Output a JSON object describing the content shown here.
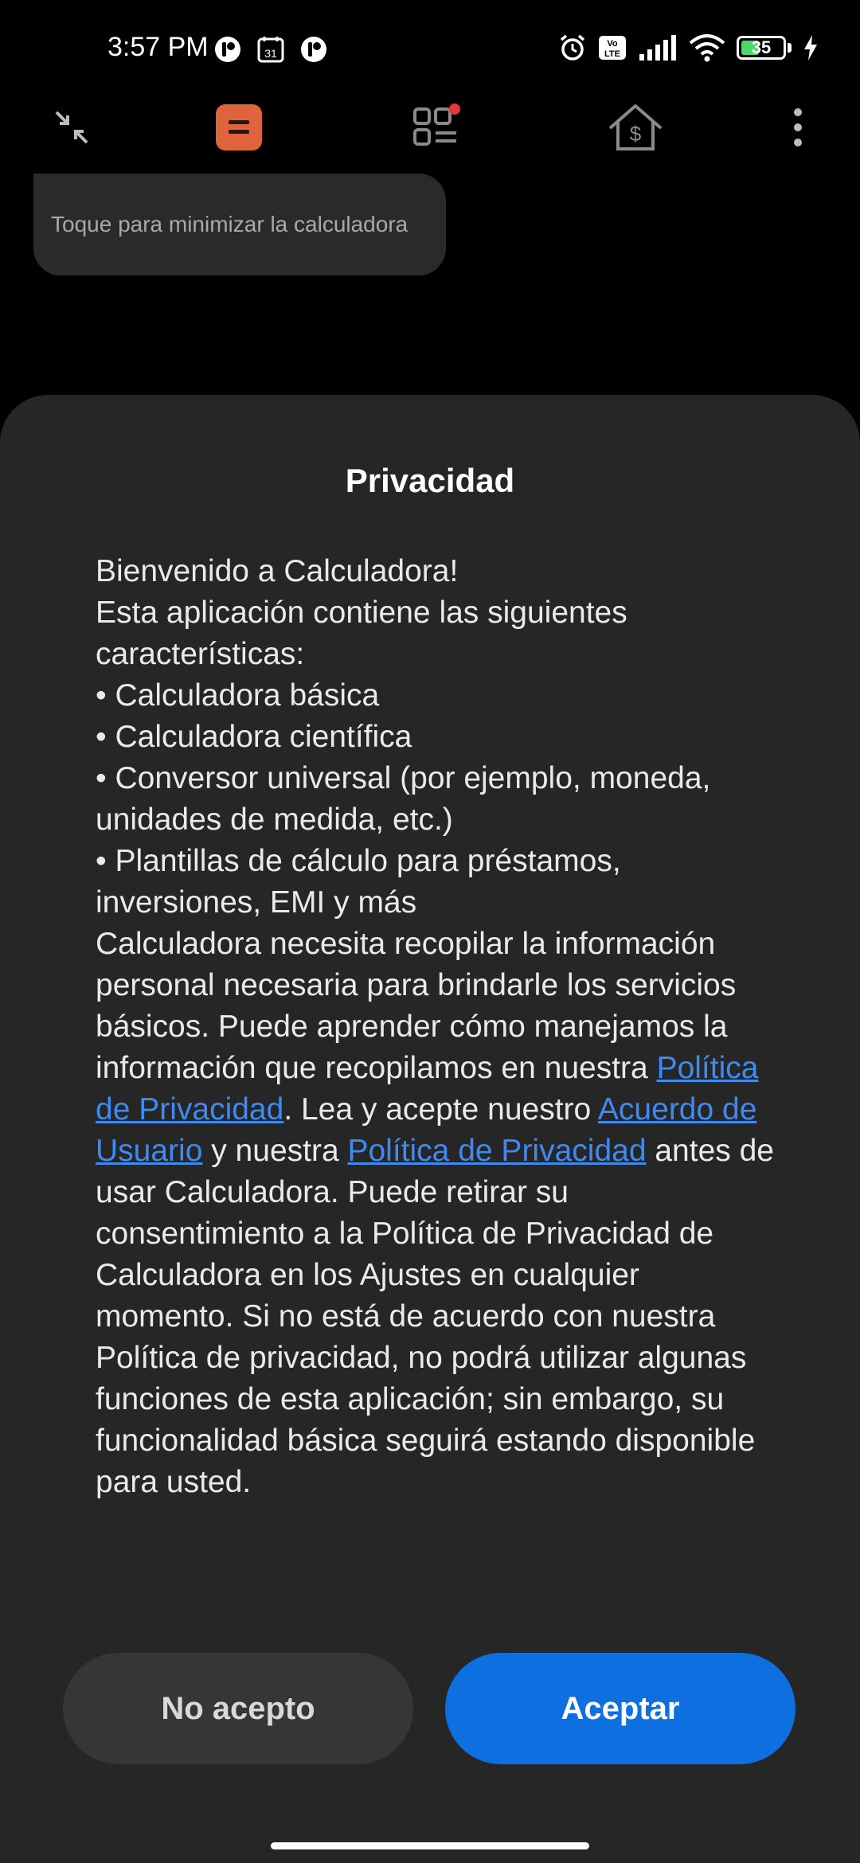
{
  "status_bar": {
    "time": "3:57 PM",
    "calendar_day": "31",
    "battery_level": "35",
    "volte_line1": "Vo",
    "volte_line2": "LTE"
  },
  "toolbar": {
    "minimize_icon": "minimize-arrows-icon",
    "calculator_icon": "calculator-icon",
    "apps_icon": "grid-list-icon",
    "finance_icon": "house-dollar-icon",
    "menu_icon": "more-vertical-icon"
  },
  "tooltip": {
    "text": "Toque para minimizar la calculadora"
  },
  "dialog": {
    "title": "Privacidad",
    "welcome": "Bienvenido a Calculadora!",
    "features_intro": "Esta aplicación contiene las siguientes características:",
    "features": [
      "• Calculadora básica",
      "• Calculadora científica",
      "• Conversor universal (por ejemplo, moneda, unidades de medida, etc.)",
      "• Plantillas de cálculo para préstamos, inversiones, EMI y más"
    ],
    "text_1": "Calculadora necesita recopilar la información personal necesaria para brindarle los servicios básicos. Puede aprender cómo manejamos la información que recopilamos en nuestra ",
    "link_privacy_1": "Política de Privacidad",
    "text_2": ". Lea y acepte nuestro ",
    "link_user_agreement": "Acuerdo de Usuario",
    "text_3": " y nuestra ",
    "link_privacy_2": "Política de Privacidad",
    "text_4": " antes de usar Calculadora. Puede retirar su consentimiento a la Política de Privacidad de Calculadora en los Ajustes en cualquier momento. Si no está de acuerdo con nuestra Política de privacidad, no podrá utilizar algunas funciones de esta aplicación; sin embargo, su funcionalidad básica seguirá estando disponible para usted.",
    "decline_label": "No acepto",
    "accept_label": "Aceptar"
  },
  "colors": {
    "accent": "#0d6fe0",
    "link": "#3d8bf2",
    "calculator_brand": "#e0643b",
    "notification_dot": "#e53935"
  }
}
